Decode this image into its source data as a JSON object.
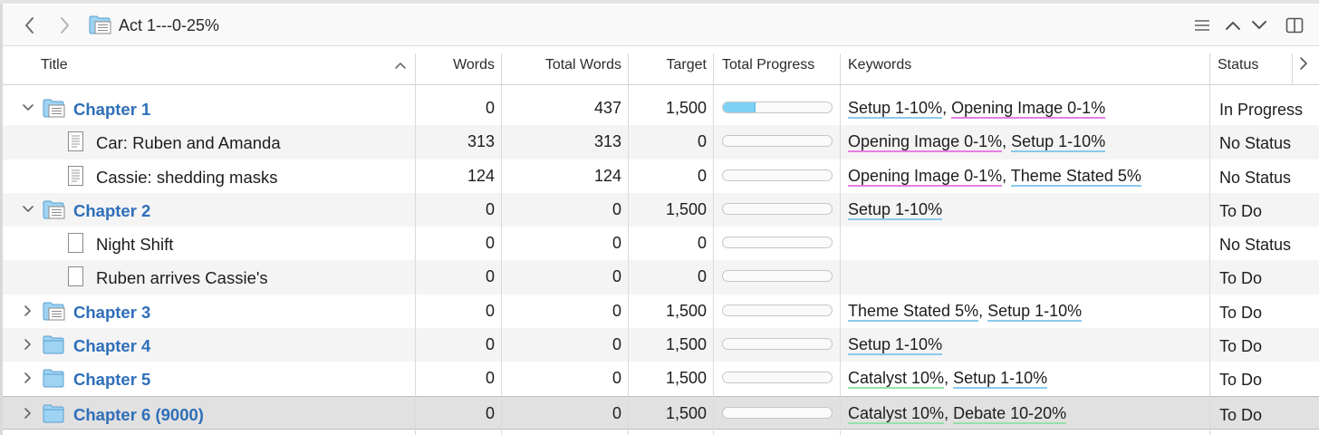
{
  "header": {
    "title": "Act 1---0-25%"
  },
  "columns": {
    "title": "Title",
    "words": "Words",
    "total_words": "Total Words",
    "target": "Target",
    "total_progress": "Total Progress",
    "keywords": "Keywords",
    "status": "Status"
  },
  "rows": [
    {
      "type": "chapter",
      "expand": "down",
      "icon": "folder-text",
      "title": "Chapter 1",
      "words": "0",
      "total_words": "437",
      "target": "1,500",
      "progress": 0.29,
      "keywords": [
        {
          "text": "Setup 1-10%",
          "color": "#8bc9ec"
        },
        {
          "text": "Opening Image 0-1%",
          "color": "#e57fe0"
        }
      ],
      "status": "In Progress"
    },
    {
      "type": "doc",
      "icon": "doc-text",
      "title": "Car: Ruben and Amanda",
      "words": "313",
      "total_words": "313",
      "target": "0",
      "progress": 0,
      "keywords": [
        {
          "text": "Opening Image 0-1%",
          "color": "#e57fe0"
        },
        {
          "text": "Setup 1-10%",
          "color": "#8bc9ec"
        }
      ],
      "status": "No Status"
    },
    {
      "type": "doc",
      "icon": "doc-text",
      "title": "Cassie: shedding masks",
      "words": "124",
      "total_words": "124",
      "target": "0",
      "progress": 0,
      "keywords": [
        {
          "text": "Opening Image 0-1%",
          "color": "#e57fe0"
        },
        {
          "text": "Theme Stated 5%",
          "color": "#8bc9ec"
        }
      ],
      "status": "No Status"
    },
    {
      "type": "chapter",
      "expand": "down",
      "icon": "folder-text",
      "title": "Chapter 2",
      "words": "0",
      "total_words": "0",
      "target": "1,500",
      "progress": 0,
      "keywords": [
        {
          "text": "Setup 1-10%",
          "color": "#8bc9ec"
        }
      ],
      "status": "To Do"
    },
    {
      "type": "doc",
      "icon": "doc-blank",
      "title": "Night Shift",
      "words": "0",
      "total_words": "0",
      "target": "0",
      "progress": 0,
      "keywords": [],
      "status": "No Status"
    },
    {
      "type": "doc",
      "icon": "doc-blank",
      "title": "Ruben arrives Cassie's",
      "words": "0",
      "total_words": "0",
      "target": "0",
      "progress": 0,
      "keywords": [],
      "status": "To Do"
    },
    {
      "type": "chapter",
      "expand": "right",
      "icon": "folder-text",
      "title": "Chapter 3",
      "words": "0",
      "total_words": "0",
      "target": "1,500",
      "progress": 0,
      "keywords": [
        {
          "text": "Theme Stated 5%",
          "color": "#8bc9ec"
        },
        {
          "text": "Setup 1-10%",
          "color": "#8bc9ec"
        }
      ],
      "status": "To Do"
    },
    {
      "type": "chapter",
      "expand": "right",
      "icon": "folder",
      "title": "Chapter 4",
      "words": "0",
      "total_words": "0",
      "target": "1,500",
      "progress": 0,
      "keywords": [
        {
          "text": "Setup 1-10%",
          "color": "#8bc9ec"
        }
      ],
      "status": "To Do"
    },
    {
      "type": "chapter",
      "expand": "right",
      "icon": "folder",
      "title": "Chapter 5",
      "words": "0",
      "total_words": "0",
      "target": "1,500",
      "progress": 0,
      "keywords": [
        {
          "text": "Catalyst 10%",
          "color": "#98e0a8"
        },
        {
          "text": "Setup 1-10%",
          "color": "#8bc9ec"
        }
      ],
      "status": "To Do"
    },
    {
      "type": "chapter",
      "expand": "right",
      "icon": "folder",
      "title": "Chapter 6 (9000)",
      "words": "0",
      "total_words": "0",
      "target": "1,500",
      "progress": 0,
      "keywords": [
        {
          "text": "Catalyst 10%",
          "color": "#98e0a8"
        },
        {
          "text": "Debate 10-20%",
          "color": "#98e0a8"
        }
      ],
      "status": "To Do",
      "selected": true
    }
  ]
}
